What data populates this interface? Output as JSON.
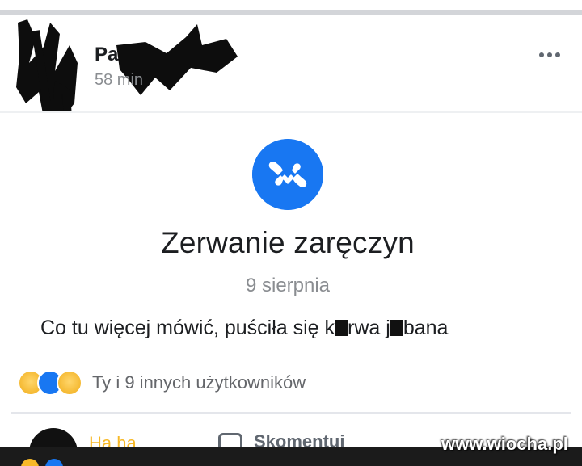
{
  "post": {
    "author_visible": "Pa",
    "timestamp": "58 min",
    "more_icon": "more-horizontal-icon"
  },
  "event": {
    "icon": "broken-heart-icon",
    "title": "Zerwanie zaręczyn",
    "date": "9 sierpnia",
    "body_parts": [
      "Co tu więcej mówić, puściła się k",
      "rwa j",
      "bana"
    ]
  },
  "reactions": {
    "icons": [
      "sad-reaction-icon",
      "like-reaction-icon",
      "haha-reaction-icon"
    ],
    "summary": "Ty i 9 innych użytkowników"
  },
  "actions": {
    "haha_label": "Ha ha",
    "comment_label": "Skomentuj"
  },
  "watermark": "www.wiocha.pl",
  "colors": {
    "accent": "#1877f2",
    "haha": "#f7b928",
    "text": "#1c1e21",
    "muted": "#8a8d91"
  }
}
